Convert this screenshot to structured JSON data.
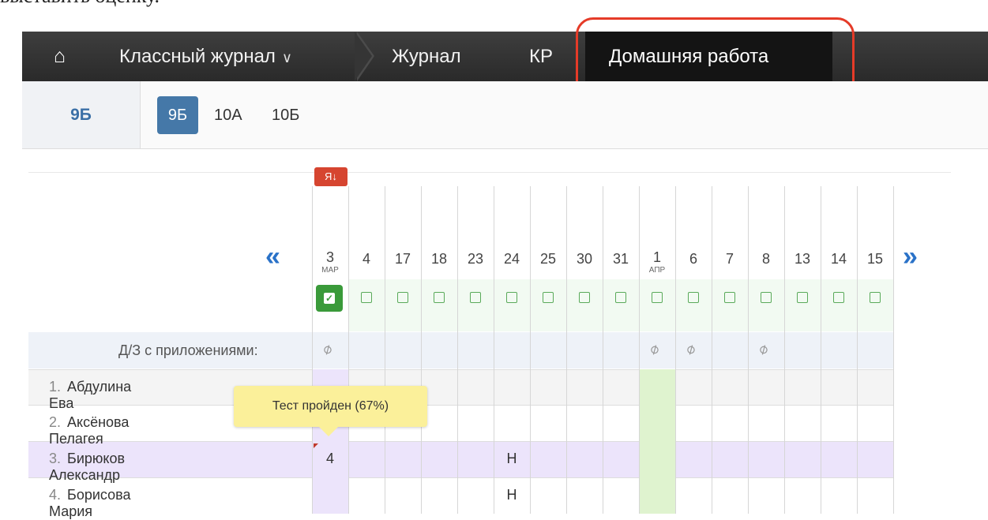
{
  "clipped_header_text": "выставить оценку.",
  "navbar": {
    "home_label": "⌂",
    "class_journal_label": "Классный журнал",
    "journal_label": "Журнал",
    "kr_label": "КР",
    "homework_label": "Домашняя работа"
  },
  "classbar": {
    "current": "9Б",
    "options": [
      "9Б",
      "10А",
      "10Б"
    ]
  },
  "sort_badge": "Я↓",
  "dates": [
    {
      "day": "3",
      "month": "МАР"
    },
    {
      "day": "4",
      "month": ""
    },
    {
      "day": "17",
      "month": ""
    },
    {
      "day": "18",
      "month": ""
    },
    {
      "day": "23",
      "month": ""
    },
    {
      "day": "24",
      "month": ""
    },
    {
      "day": "25",
      "month": ""
    },
    {
      "day": "30",
      "month": ""
    },
    {
      "day": "31",
      "month": ""
    },
    {
      "day": "1",
      "month": "АПР"
    },
    {
      "day": "6",
      "month": ""
    },
    {
      "day": "7",
      "month": ""
    },
    {
      "day": "8",
      "month": ""
    },
    {
      "day": "13",
      "month": ""
    },
    {
      "day": "14",
      "month": ""
    },
    {
      "day": "15",
      "month": ""
    }
  ],
  "attachments_label": "Д/З с приложениями:",
  "attachment_columns": [
    0,
    9,
    10,
    12
  ],
  "students": [
    {
      "num": "1.",
      "name": "Абдулина Ева",
      "marks": []
    },
    {
      "num": "2.",
      "name": "Аксёнова Пелагея",
      "marks": []
    },
    {
      "num": "3.",
      "name": "Бирюков Александр",
      "marks": [
        {
          "col": 0,
          "text": "4"
        },
        {
          "col": 5,
          "text": "Н"
        }
      ]
    },
    {
      "num": "4.",
      "name": "Борисова Мария",
      "marks": [
        {
          "col": 5,
          "text": "Н"
        }
      ]
    }
  ],
  "tooltip": "Тест пройден (67%)",
  "colors": {
    "accent_blue": "#4578a8",
    "highlight_red": "#e53b28",
    "check_green": "#3a9a3a"
  }
}
